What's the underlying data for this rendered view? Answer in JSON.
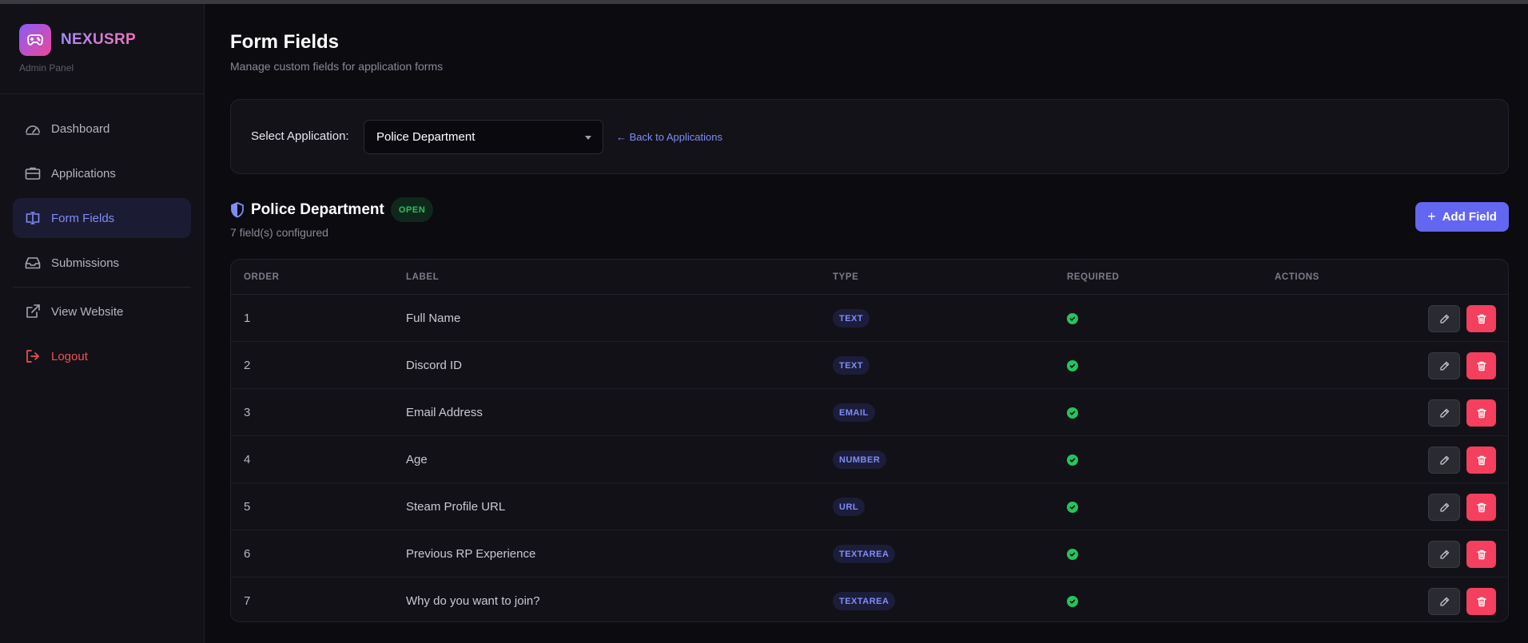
{
  "brand": {
    "name": "NEXUSRP",
    "subtitle": "Admin Panel",
    "logo_gradient": [
      "#8b5cf6",
      "#ec4899"
    ]
  },
  "sidebar": {
    "items": [
      {
        "label": "Dashboard",
        "icon": "gauge-icon"
      },
      {
        "label": "Applications",
        "icon": "briefcase-icon"
      },
      {
        "label": "Form Fields",
        "icon": "form-input-icon",
        "active": true
      },
      {
        "label": "Submissions",
        "icon": "inbox-icon"
      },
      {
        "label": "View Website",
        "icon": "external-link-icon"
      },
      {
        "label": "Logout",
        "icon": "logout-icon",
        "danger": true
      }
    ]
  },
  "header": {
    "title": "Form Fields",
    "subtitle": "Manage custom fields for application forms"
  },
  "selector": {
    "label": "Select Application:",
    "selected": "Police Department",
    "back_link": "← Back to Applications"
  },
  "application": {
    "name": "Police Department",
    "status": "OPEN",
    "count_text": "7 field(s) configured",
    "add_button": "Add Field"
  },
  "table": {
    "headers": {
      "order": "ORDER",
      "label": "LABEL",
      "type": "TYPE",
      "required": "REQUIRED",
      "actions": "ACTIONS"
    },
    "rows": [
      {
        "order": "1",
        "label": "Full Name",
        "type": "TEXT",
        "required": true
      },
      {
        "order": "2",
        "label": "Discord ID",
        "type": "TEXT",
        "required": true
      },
      {
        "order": "3",
        "label": "Email Address",
        "type": "EMAIL",
        "required": true
      },
      {
        "order": "4",
        "label": "Age",
        "type": "NUMBER",
        "required": true
      },
      {
        "order": "5",
        "label": "Steam Profile URL",
        "type": "URL",
        "required": true
      },
      {
        "order": "6",
        "label": "Previous RP Experience",
        "type": "TEXTAREA",
        "required": true
      },
      {
        "order": "7",
        "label": "Why do you want to join?",
        "type": "TEXTAREA",
        "required": true
      }
    ]
  },
  "colors": {
    "accent": "#6366f1",
    "success": "#22c55e",
    "danger": "#f43f5e"
  }
}
